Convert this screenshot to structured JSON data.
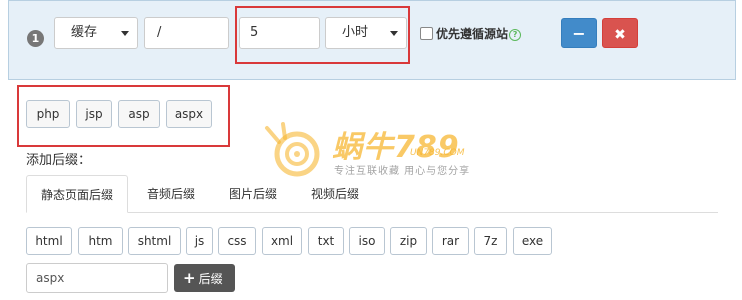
{
  "rule": {
    "index": "1",
    "type_select": "缓存",
    "path_value": "/",
    "duration_value": "5",
    "unit_select": "小时",
    "prefer_origin_label": "优先遵循源站",
    "help_icon": "?",
    "minus_label": "−",
    "close_label": "✖"
  },
  "preset_tags": [
    "php",
    "jsp",
    "asp",
    "aspx"
  ],
  "add_suffix_label": "添加后缀：",
  "tabs": [
    {
      "label": "静态页面后缀",
      "active": true
    },
    {
      "label": "音频后缀",
      "active": false
    },
    {
      "label": "图片后缀",
      "active": false
    },
    {
      "label": "视频后缀",
      "active": false
    }
  ],
  "suffix_options": [
    "html",
    "htm",
    "shtml",
    "js",
    "css",
    "xml",
    "txt",
    "iso",
    "zip",
    "rar",
    "7z",
    "exe"
  ],
  "custom_suffix_value": "aspx",
  "add_button": {
    "icon": "+",
    "label": "后缀"
  },
  "watermark": {
    "title": "蜗牛789",
    "domain": "UN789.COM",
    "slogan": "专注互联收藏 用心与您分享"
  },
  "colors": {
    "panel_bg": "#e6f0f8",
    "primary": "#428bca",
    "danger": "#d9534f",
    "highlight_box": "#d9393a",
    "watermark": "#f7b733"
  }
}
